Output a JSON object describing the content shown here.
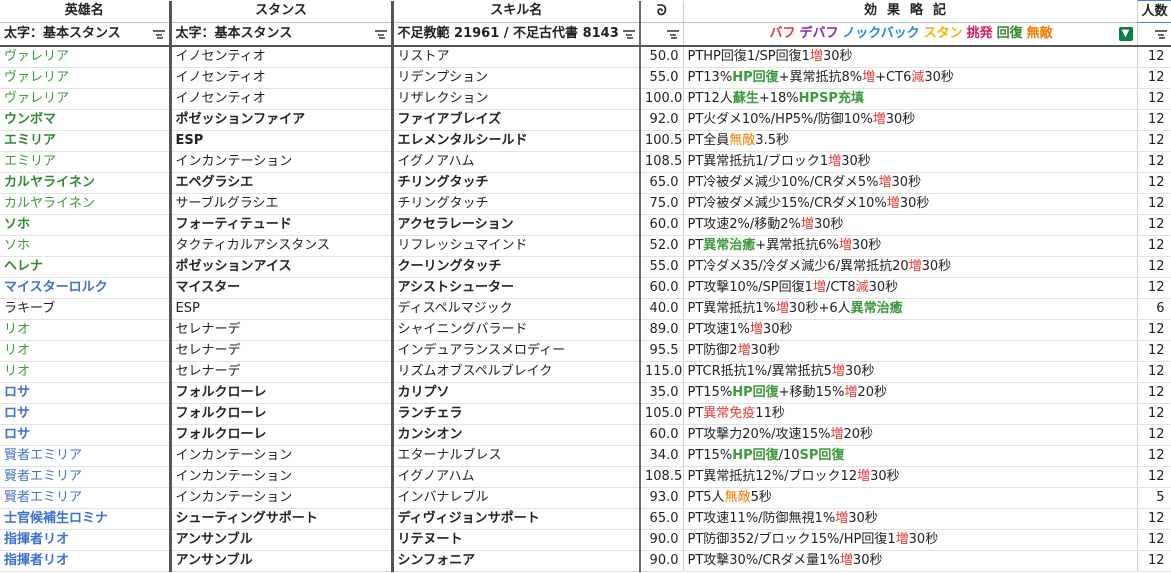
{
  "headers": {
    "hero": "英雄名",
    "stance": "スタンス",
    "skill": "スキル名",
    "sort_icon": "ᘐ",
    "effect": "効果略記",
    "count": "人数"
  },
  "filters": {
    "hero": "太字：基本スタンス",
    "stance": "太字：基本スタンス",
    "skill": "不足教範 21961 / 不足古代書 8143"
  },
  "legend": [
    {
      "text": "バフ",
      "color": "#e53935"
    },
    {
      "text": "デバフ",
      "color": "#8e24aa"
    },
    {
      "text": "ノックバック",
      "color": "#1e88e5"
    },
    {
      "text": "スタン",
      "color": "#f4b400"
    },
    {
      "text": "挑発",
      "color": "#d81b60"
    },
    {
      "text": "回復",
      "color": "#2e8a2e"
    },
    {
      "text": "無敵",
      "color": "#ef7c00"
    }
  ],
  "rows": [
    {
      "hero": "ヴァレリア",
      "hs": "green",
      "stance": "イノセンティオ",
      "sb": false,
      "skill": "リストア",
      "val": "50.0",
      "effect": [
        [
          "PTHP回復1/SP回復1",
          ""
        ],
        [
          "増",
          "r"
        ],
        [
          "30秒",
          ""
        ]
      ],
      "count": "12"
    },
    {
      "hero": "ヴァレリア",
      "hs": "green",
      "stance": "イノセンティオ",
      "sb": false,
      "skill": "リデンプション",
      "val": "55.0",
      "effect": [
        [
          "PT13%",
          ""
        ],
        [
          "HP回復",
          "hi"
        ],
        [
          "+異常抵抗8%",
          ""
        ],
        [
          "増",
          "r"
        ],
        [
          "+CT6",
          ""
        ],
        [
          "減",
          "r"
        ],
        [
          "30秒",
          ""
        ]
      ],
      "count": "12"
    },
    {
      "hero": "ヴァレリア",
      "hs": "green",
      "stance": "イノセンティオ",
      "sb": false,
      "skill": "リザレクション",
      "val": "100.0",
      "effect": [
        [
          "PT12人",
          ""
        ],
        [
          "蘇生",
          "hi"
        ],
        [
          "+18%",
          ""
        ],
        [
          "HPSP充填",
          "hi"
        ]
      ],
      "count": "12"
    },
    {
      "hero": "ウンボマ",
      "hs": "greenb",
      "stance": "ポゼッションファイア",
      "sb": true,
      "skill": "ファイアブレイズ",
      "val": "92.0",
      "effect": [
        [
          "PT火ダメ10%/HP5%/防御10%",
          ""
        ],
        [
          "増",
          "r"
        ],
        [
          "30秒",
          ""
        ]
      ],
      "count": "12"
    },
    {
      "hero": "エミリア",
      "hs": "greenb",
      "stance": "ESP",
      "sb": true,
      "skill": "エレメンタルシールド",
      "val": "100.5",
      "effect": [
        [
          "PT全員",
          ""
        ],
        [
          "無敵",
          "warn"
        ],
        [
          "3.5秒",
          ""
        ]
      ],
      "count": "12"
    },
    {
      "hero": "エミリア",
      "hs": "green",
      "stance": "インカンテーション",
      "sb": false,
      "skill": "イグノアハム",
      "val": "108.5",
      "effect": [
        [
          "PT異常抵抗1/ブロック1",
          ""
        ],
        [
          "増",
          "r"
        ],
        [
          "30秒",
          ""
        ]
      ],
      "count": "12"
    },
    {
      "hero": "カルヤライネン",
      "hs": "greenb",
      "stance": "エペグラシエ",
      "sb": true,
      "skill": "チリングタッチ",
      "val": "65.0",
      "effect": [
        [
          "PT冷被ダメ減少10%/CRダメ5%",
          ""
        ],
        [
          "増",
          "r"
        ],
        [
          "30秒",
          ""
        ]
      ],
      "count": "12"
    },
    {
      "hero": "カルヤライネン",
      "hs": "green",
      "stance": "サーブルグラシエ",
      "sb": false,
      "skill": "チリングタッチ",
      "val": "75.0",
      "effect": [
        [
          "PT冷被ダメ減少15%/CRダメ10%",
          ""
        ],
        [
          "増",
          "r"
        ],
        [
          "30秒",
          ""
        ]
      ],
      "count": "12"
    },
    {
      "hero": "ソホ",
      "hs": "greenb",
      "stance": "フォーティテュード",
      "sb": true,
      "skill": "アクセラレーション",
      "val": "60.0",
      "effect": [
        [
          "PT攻速2%/移動2%",
          ""
        ],
        [
          "増",
          "r"
        ],
        [
          "30秒",
          ""
        ]
      ],
      "count": "12"
    },
    {
      "hero": "ソホ",
      "hs": "green",
      "stance": "タクティカルアシスタンス",
      "sb": false,
      "skill": "リフレッシュマインド",
      "val": "52.0",
      "effect": [
        [
          "PT",
          ""
        ],
        [
          "異常治癒",
          "hi"
        ],
        [
          "+異常抵抗6%",
          ""
        ],
        [
          "増",
          "r"
        ],
        [
          "30秒",
          ""
        ]
      ],
      "count": "12"
    },
    {
      "hero": "ヘレナ",
      "hs": "greenb",
      "stance": "ポゼッションアイス",
      "sb": true,
      "skill": "クーリングタッチ",
      "val": "55.0",
      "effect": [
        [
          "PT冷ダメ35/冷ダメ減少6/異常抵抗20",
          ""
        ],
        [
          "増",
          "r"
        ],
        [
          "30秒",
          ""
        ]
      ],
      "count": "12"
    },
    {
      "hero": "マイスターロルク",
      "hs": "blueb",
      "stance": "マイスター",
      "sb": true,
      "skill": "アシストシューター",
      "val": "60.0",
      "effect": [
        [
          "PT攻撃10%/SP回復1",
          ""
        ],
        [
          "増",
          "r"
        ],
        [
          "/CT8",
          ""
        ],
        [
          "減",
          "r"
        ],
        [
          "30秒",
          ""
        ]
      ],
      "count": "12"
    },
    {
      "hero": "ラキーブ",
      "hs": "",
      "stance": "ESP",
      "sb": false,
      "skill": "ディスペルマジック",
      "val": "40.0",
      "effect": [
        [
          "PT異常抵抗1%",
          ""
        ],
        [
          "増",
          "r"
        ],
        [
          "30秒+6人",
          ""
        ],
        [
          "異常治癒",
          "hi"
        ]
      ],
      "count": "6"
    },
    {
      "hero": "リオ",
      "hs": "green",
      "stance": "セレナーデ",
      "sb": false,
      "skill": "シャイニングバラード",
      "val": "89.0",
      "effect": [
        [
          "PT攻速1%",
          ""
        ],
        [
          "増",
          "r"
        ],
        [
          "30秒",
          ""
        ]
      ],
      "count": "12"
    },
    {
      "hero": "リオ",
      "hs": "green",
      "stance": "セレナーデ",
      "sb": false,
      "skill": "インデュアランスメロディー",
      "val": "95.5",
      "effect": [
        [
          "PT防御2",
          ""
        ],
        [
          "増",
          "r"
        ],
        [
          "30秒",
          ""
        ]
      ],
      "count": "12"
    },
    {
      "hero": "リオ",
      "hs": "green",
      "stance": "セレナーデ",
      "sb": false,
      "skill": "リズムオブスペルブレイク",
      "val": "115.0",
      "effect": [
        [
          "PTCR抵抗1%/異常抵抗5",
          ""
        ],
        [
          "増",
          "r"
        ],
        [
          "30秒",
          ""
        ]
      ],
      "count": "12"
    },
    {
      "hero": "ロサ",
      "hs": "blueb",
      "stance": "フォルクローレ",
      "sb": true,
      "skill": "カリプソ",
      "val": "35.0",
      "effect": [
        [
          "PT15%",
          ""
        ],
        [
          "HP回復",
          "hi"
        ],
        [
          "+移動15%",
          ""
        ],
        [
          "増",
          "r"
        ],
        [
          "20秒",
          ""
        ]
      ],
      "count": "12"
    },
    {
      "hero": "ロサ",
      "hs": "blueb",
      "stance": "フォルクローレ",
      "sb": true,
      "skill": "ランチェラ",
      "val": "105.0",
      "effect": [
        [
          "PT",
          ""
        ],
        [
          "異常免疫",
          "r"
        ],
        [
          "11秒",
          ""
        ]
      ],
      "count": "12"
    },
    {
      "hero": "ロサ",
      "hs": "blueb",
      "stance": "フォルクローレ",
      "sb": true,
      "skill": "カンシオン",
      "val": "60.0",
      "effect": [
        [
          "PT攻撃力20%/攻速15%",
          ""
        ],
        [
          "増",
          "r"
        ],
        [
          "20秒",
          ""
        ]
      ],
      "count": "12"
    },
    {
      "hero": "賢者エミリア",
      "hs": "blue",
      "stance": "インカンテーション",
      "sb": false,
      "skill": "エターナルブレス",
      "val": "34.0",
      "effect": [
        [
          "PT15%",
          ""
        ],
        [
          "HP回復",
          "hi"
        ],
        [
          "/10",
          ""
        ],
        [
          "SP回復",
          "hi"
        ]
      ],
      "count": "12"
    },
    {
      "hero": "賢者エミリア",
      "hs": "blue",
      "stance": "インカンテーション",
      "sb": false,
      "skill": "イグノアハム",
      "val": "108.5",
      "effect": [
        [
          "PT異常抵抗12%/ブロック12",
          ""
        ],
        [
          "増",
          "r"
        ],
        [
          "30秒",
          ""
        ]
      ],
      "count": "12"
    },
    {
      "hero": "賢者エミリア",
      "hs": "blue",
      "stance": "インカンテーション",
      "sb": false,
      "skill": "インバナレブル",
      "val": "93.0",
      "effect": [
        [
          "PT5人",
          ""
        ],
        [
          "無敵",
          "warn"
        ],
        [
          "5秒",
          ""
        ]
      ],
      "count": "5"
    },
    {
      "hero": "士官候補生ロミナ",
      "hs": "blueb",
      "stance": "シューティングサポート",
      "sb": true,
      "skill": "ディヴィジョンサポート",
      "val": "65.0",
      "effect": [
        [
          "PT攻速11%/防御無視1%",
          ""
        ],
        [
          "増",
          "r"
        ],
        [
          "30秒",
          ""
        ]
      ],
      "count": "12"
    },
    {
      "hero": "指揮者リオ",
      "hs": "blueb",
      "stance": "アンサンブル",
      "sb": true,
      "skill": "リテヌート",
      "val": "90.0",
      "effect": [
        [
          "PT防御352/ブロック15%/HP回復1",
          ""
        ],
        [
          "増",
          "r"
        ],
        [
          "30秒",
          ""
        ]
      ],
      "count": "12"
    },
    {
      "hero": "指揮者リオ",
      "hs": "blueb",
      "stance": "アンサンブル",
      "sb": true,
      "skill": "シンフォニア",
      "val": "90.0",
      "effect": [
        [
          "PT攻撃30%/CRダメ量1%",
          ""
        ],
        [
          "増",
          "r"
        ],
        [
          "30秒",
          ""
        ]
      ],
      "count": "12"
    }
  ]
}
